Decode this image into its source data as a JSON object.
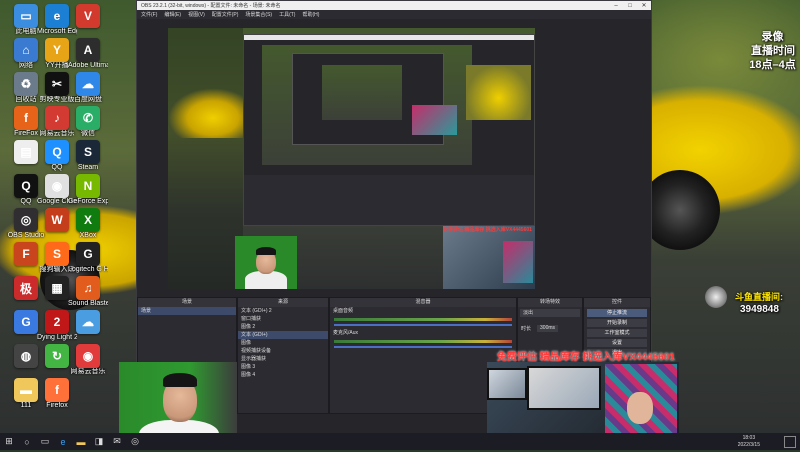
{
  "desktop": {
    "icons": [
      {
        "label": "此电脑",
        "color": "#3b8de0",
        "glyph": "▭"
      },
      {
        "label": "Microsoft Edge",
        "color": "#1b7fd4",
        "glyph": "e"
      },
      {
        "label": "",
        "color": "#d23a2e",
        "glyph": "V"
      },
      {
        "label": "网络",
        "color": "#3a7ad0",
        "glyph": "⌂"
      },
      {
        "label": "YY开播",
        "color": "#e8a417",
        "glyph": "Y"
      },
      {
        "label": "Adobe Ultimate",
        "color": "#2d2d2d",
        "glyph": "A"
      },
      {
        "label": "回收站",
        "color": "#6b7b8b",
        "glyph": "♻"
      },
      {
        "label": "剪映专业版",
        "color": "#111111",
        "glyph": "✂"
      },
      {
        "label": "百度网盘",
        "color": "#2f87e8",
        "glyph": "☁"
      },
      {
        "label": "FireFox",
        "color": "#e8631a",
        "glyph": "f"
      },
      {
        "label": "网易云音乐",
        "color": "#d33a31",
        "glyph": "♪"
      },
      {
        "label": "微信",
        "color": "#2aae67",
        "glyph": "✆"
      },
      {
        "label": "",
        "color": "#eeeeee",
        "glyph": "▤"
      },
      {
        "label": "QQ",
        "color": "#1e90ff",
        "glyph": "Q"
      },
      {
        "label": "Steam",
        "color": "#1b2838",
        "glyph": "S"
      },
      {
        "label": "QQ",
        "color": "#111111",
        "glyph": "Q"
      },
      {
        "label": "Google Chrome",
        "color": "#e0e0e0",
        "glyph": "◉"
      },
      {
        "label": "GeForce Experience",
        "color": "#76b900",
        "glyph": "N"
      },
      {
        "label": "OBS Studio",
        "color": "#302e31",
        "glyph": "◎"
      },
      {
        "label": "",
        "color": "#c43e1c",
        "glyph": "W"
      },
      {
        "label": "XBox",
        "color": "#107c10",
        "glyph": "X"
      },
      {
        "label": "",
        "color": "#c8451e",
        "glyph": "F"
      },
      {
        "label": "搜狗输入法",
        "color": "#ff6a1a",
        "glyph": "S"
      },
      {
        "label": "Logitech G HUB",
        "color": "#222222",
        "glyph": "G"
      },
      {
        "label": "",
        "color": "#cc2b2b",
        "glyph": "极"
      },
      {
        "label": "",
        "color": "#222222",
        "glyph": "▦"
      },
      {
        "label": "Sound Blaster",
        "color": "#e25c1d",
        "glyph": "♫"
      },
      {
        "label": "",
        "color": "#3a7ae0",
        "glyph": "G"
      },
      {
        "label": "Dying Light 2",
        "color": "#c01818",
        "glyph": "2"
      },
      {
        "label": "",
        "color": "#4a9de0",
        "glyph": "☁"
      },
      {
        "label": "",
        "color": "#444444",
        "glyph": "◍"
      },
      {
        "label": "",
        "color": "#43b543",
        "glyph": "↻"
      },
      {
        "label": "网易云音乐",
        "color": "#e23b3b",
        "glyph": "◉"
      },
      {
        "label": "111",
        "color": "#f0c75a",
        "glyph": "▬"
      },
      {
        "label": "Firefox",
        "color": "#ff7139",
        "glyph": "f"
      }
    ]
  },
  "obs": {
    "title": "OBS 23.2.1 (32-bit, windows) - 配置文件: 未命名 - 场景: 未命名",
    "menu": [
      "文件(F)",
      "编辑(E)",
      "视图(V)",
      "配置文件(P)",
      "场景集合(S)",
      "工具(T)",
      "帮助(H)"
    ],
    "scenes": {
      "header": "场景",
      "items": [
        "场景"
      ]
    },
    "sources": {
      "header": "来源",
      "items": [
        "文本 (GDI+) 2",
        "窗口捕获",
        "图像 2",
        "文本 (GDI+)",
        "图像",
        "视频捕获设备",
        "显示器捕获",
        "图像 3",
        "图像 4"
      ]
    },
    "mixer": {
      "header": "混音器",
      "channels": [
        "桌面音频",
        "麦克风/Aux"
      ]
    },
    "transitions": {
      "header": "转场特效",
      "type": "淡出",
      "duration_label": "时长",
      "duration_value": "300ms"
    },
    "controls": {
      "header": "控件",
      "buttons": [
        "停止推流",
        "开始录制",
        "工作室模式",
        "设置",
        "退出"
      ]
    }
  },
  "overlay": {
    "record_label": "录像",
    "live_label": "直播时间",
    "live_hours": "18点–4点",
    "channel_label": "斗鱼直播间:",
    "room_number": "3949848",
    "promo": "免费评估 精品库存 挑选入库VX4445601"
  },
  "taskbar": {
    "start_icon": "windows-start-icon",
    "time": "18:03",
    "date": "2022/3/15"
  }
}
